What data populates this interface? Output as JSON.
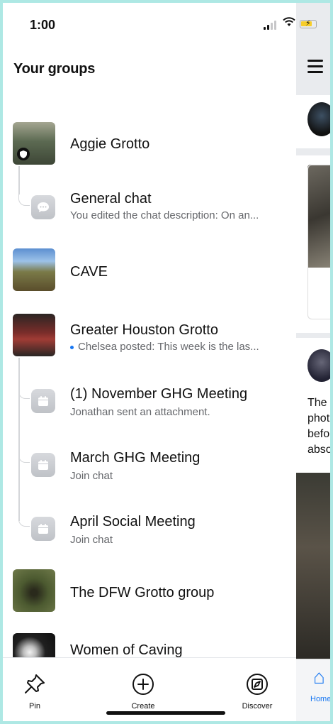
{
  "status_bar": {
    "time": "1:00"
  },
  "header": {
    "title": "Your groups"
  },
  "groups": [
    {
      "title": "Aggie Grotto",
      "thumb_colors": [
        "#4b5a44",
        "#8d8c7b"
      ]
    },
    {
      "title": "General chat",
      "subtitle": "You edited the chat description: On an..."
    },
    {
      "title": "CAVE",
      "thumb_colors": [
        "#3e6fb6",
        "#8a7a4d"
      ]
    },
    {
      "title": "Greater Houston Grotto",
      "subtitle": "Chelsea posted: This week is the las...",
      "thumb_colors": [
        "#2a2522",
        "#9b3a35"
      ]
    },
    {
      "title": "(1) November GHG Meeting",
      "subtitle": "Jonathan sent an attachment."
    },
    {
      "title": "March GHG Meeting",
      "subtitle": "Join chat"
    },
    {
      "title": "April Social Meeting",
      "subtitle": "Join chat"
    },
    {
      "title": "The DFW Grotto group",
      "thumb_colors": [
        "#3b4a2a",
        "#6f6e3e"
      ]
    },
    {
      "title": "Women of Caving",
      "thumb_colors": [
        "#111111",
        "#d9d9d9"
      ]
    }
  ],
  "tabbar": {
    "pin": "Pin",
    "create": "Create",
    "discover": "Discover"
  },
  "peek": {
    "text_lines": [
      "The",
      "phot",
      "befo",
      "abso"
    ],
    "home_label": "Home"
  },
  "colors": {
    "accent": "#1877f2",
    "secondary_text": "#65676b"
  }
}
